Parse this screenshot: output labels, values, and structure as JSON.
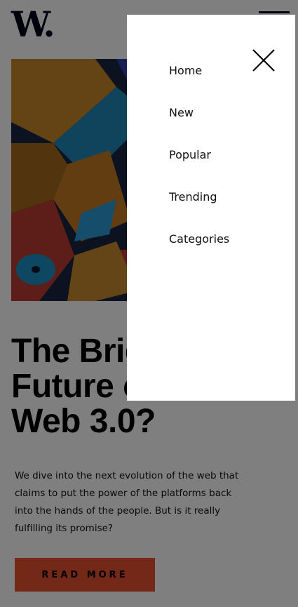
{
  "header": {
    "logo_text": "W."
  },
  "hero": {
    "title_lines": [
      "The Bright",
      "Future of",
      "Web 3.0?"
    ],
    "description": "We dive into the next evolution of the web that claims to put the power of the platforms back into the hands of the people. But is it really fulfilling its promise?",
    "cta_label": "READ MORE"
  },
  "menu": {
    "items": [
      {
        "label": "Home"
      },
      {
        "label": "New"
      },
      {
        "label": "Popular"
      },
      {
        "label": "Trending"
      },
      {
        "label": "Categories"
      }
    ]
  },
  "colors": {
    "accent": "#e8502f",
    "overlay": "rgba(0,0,0,0.5)",
    "ink": "#00001a"
  }
}
